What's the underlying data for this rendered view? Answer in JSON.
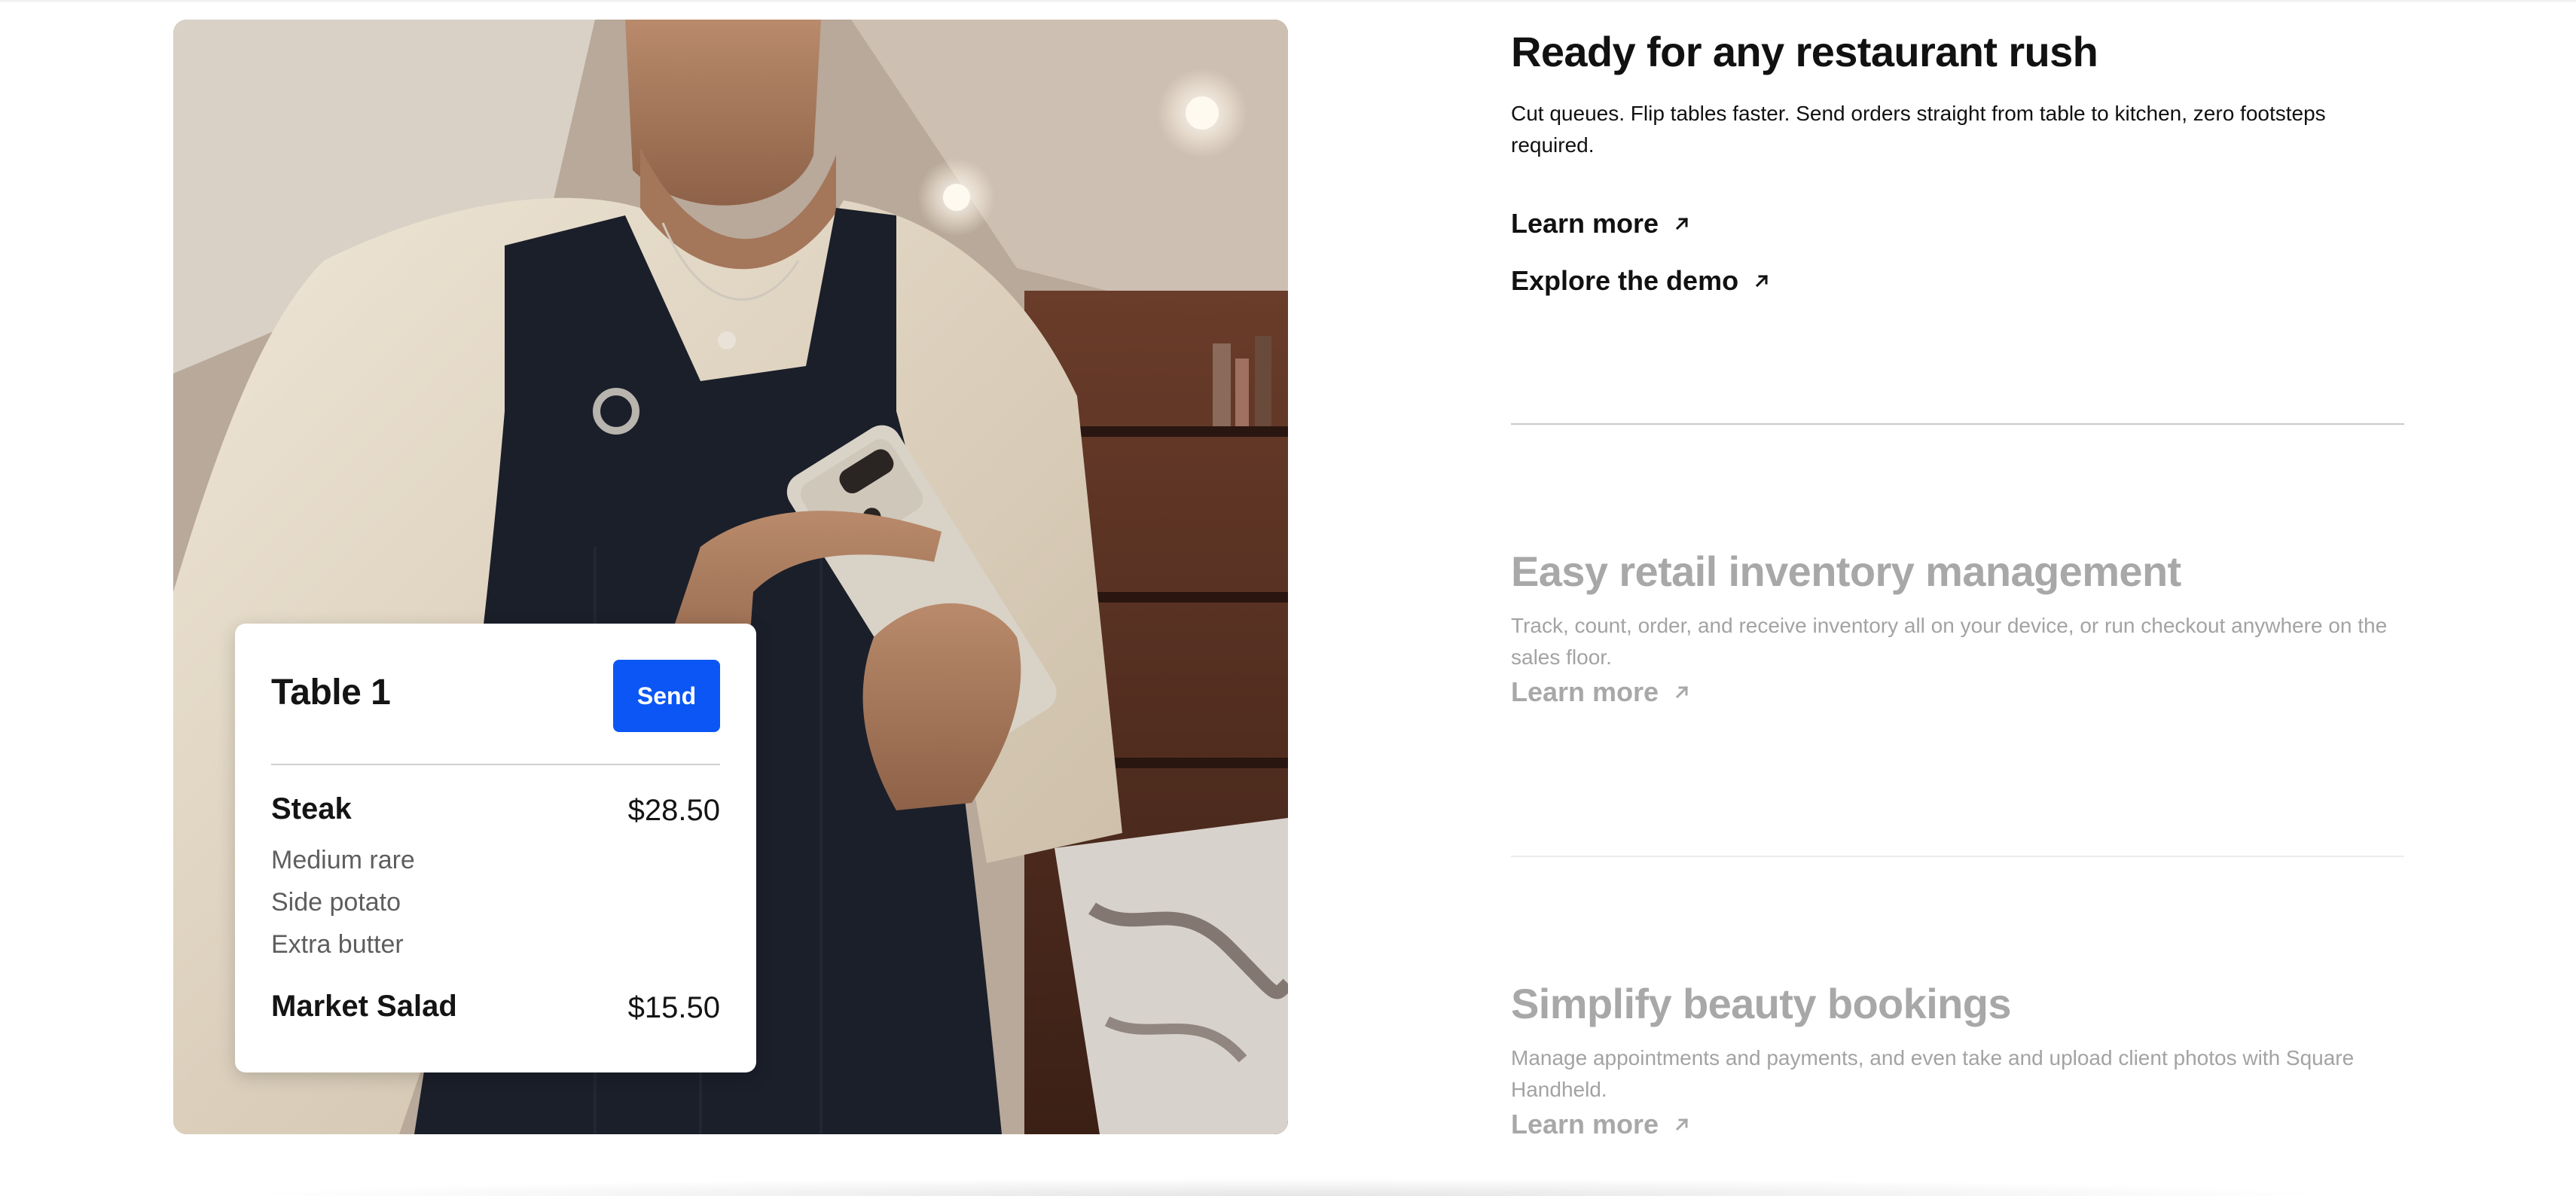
{
  "hero": {
    "image_alt": "Server in a dark apron taking an order on a handheld device",
    "order_card": {
      "title": "Table 1",
      "send_label": "Send",
      "items": [
        {
          "name": "Steak",
          "price": "$28.50",
          "modifiers": [
            "Medium rare",
            "Side potato",
            "Extra butter"
          ]
        },
        {
          "name": "Market Salad",
          "price": "$15.50",
          "modifiers": []
        }
      ],
      "send_button_color": "#0b56f5"
    }
  },
  "features": [
    {
      "title": "Ready for any restaurant rush",
      "description": "Cut queues. Flip tables faster. Send orders straight from table to kitchen, zero footsteps required.",
      "links": [
        "Learn more",
        "Explore the demo"
      ],
      "state": "active"
    },
    {
      "title": "Easy retail inventory management",
      "description": "Track, count, order, and receive inventory all on your device, or run checkout anywhere on the sales floor.",
      "links": [
        "Learn more"
      ],
      "state": "inactive"
    },
    {
      "title": "Simplify beauty bookings",
      "description": "Manage appointments and payments, and even take and upload client photos with Square Handheld.",
      "links": [
        "Learn more"
      ],
      "state": "inactive"
    }
  ],
  "icons": {
    "link_arrow": "arrow-up-right-icon"
  },
  "colors": {
    "active_text": "#111111",
    "inactive_text": "#a8a8a8",
    "accent": "#0b56f5"
  }
}
